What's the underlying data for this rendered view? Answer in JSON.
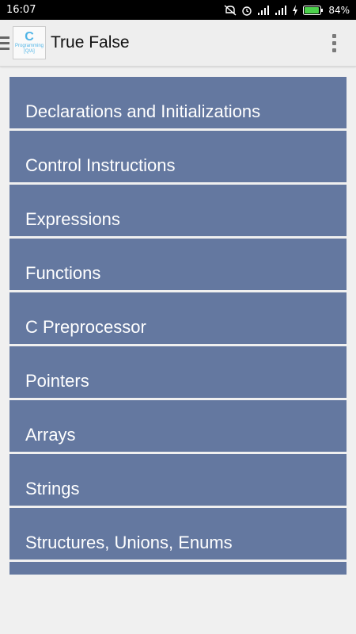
{
  "status_bar": {
    "time": "16:07",
    "battery_percent": "84%",
    "icons": [
      "mute-icon",
      "alarm-icon",
      "signal-icon",
      "signal-icon",
      "charging-icon",
      "battery-icon"
    ]
  },
  "app_bar": {
    "logo": {
      "big": "C",
      "small": "Programming",
      "tiny": "[Q/A]"
    },
    "title": "True False",
    "menu_icon": "overflow-menu-icon"
  },
  "topics": [
    "Declarations and Initializations",
    "Control Instructions",
    "Expressions",
    "Functions",
    "C Preprocessor",
    "Pointers",
    "Arrays",
    "Strings",
    "Structures, Unions, Enums"
  ],
  "colors": {
    "item_bg": "#6478a0",
    "item_text": "#ffffff",
    "app_bar_bg": "#eeeeee",
    "page_bg": "#f0f0f0"
  }
}
